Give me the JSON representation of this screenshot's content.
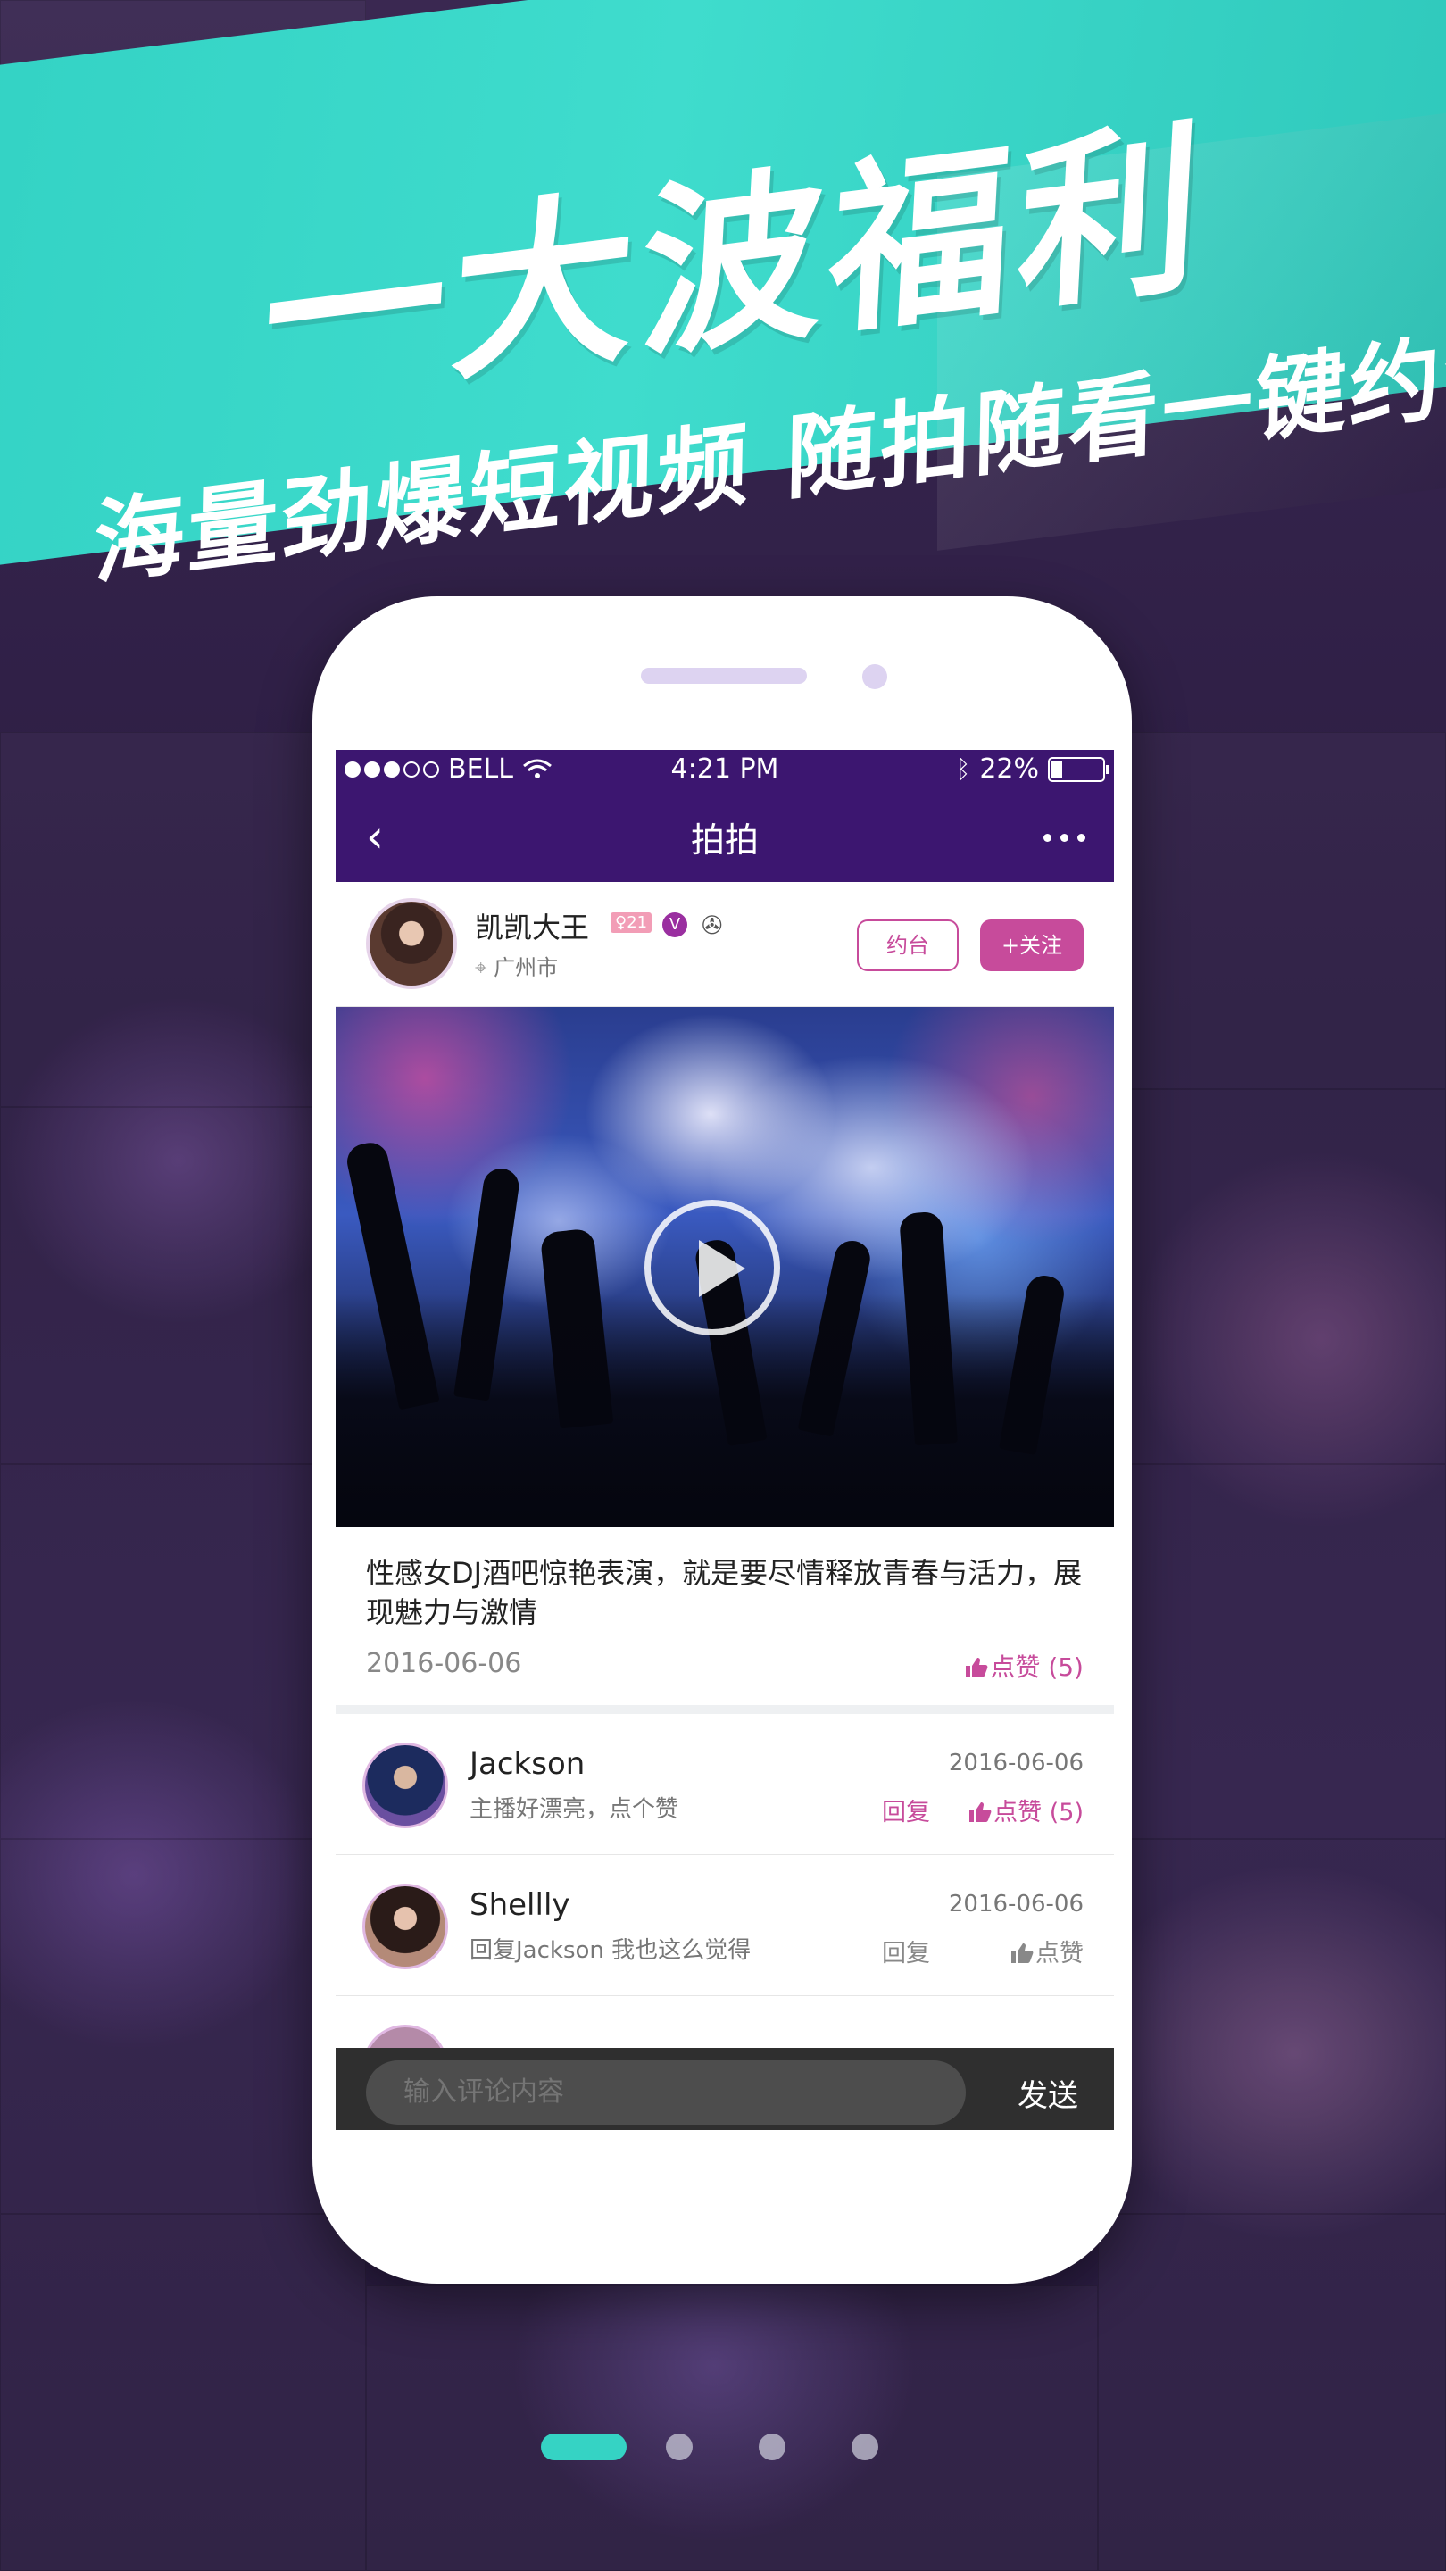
{
  "banner": {
    "headline": "一大波福利",
    "subline": "海量劲爆短视频  随拍随看一键约会",
    "color": "#35d3c4"
  },
  "status_bar": {
    "carrier": "BELL",
    "time": "4:21 PM",
    "battery": "22%",
    "icons": [
      "signal-dots-icon",
      "wifi-icon",
      "bluetooth-icon",
      "battery-icon"
    ]
  },
  "nav": {
    "back_icon": "chevron-left-icon",
    "title": "拍拍",
    "more_icon": "more-dots-icon"
  },
  "post": {
    "user_name": "凯凯大王",
    "level_badge": "21",
    "vip_badge": "V",
    "location": "广州市",
    "date_button": "约台",
    "follow_button": "+关注",
    "description": "性感女DJ酒吧惊艳表演，就是要尽情释放青春与活力，展现魅力与激情",
    "date": "2016-06-06",
    "like_label": "点赞 (5)",
    "accent": "#c74b9b"
  },
  "comments": [
    {
      "name": "Jackson",
      "text": "主播好漂亮，点个赞",
      "date": "2016-06-06",
      "reply_label": "回复",
      "like_label": "点赞 (5)"
    },
    {
      "name": "Shellly",
      "text": "回复Jackson  我也这么觉得",
      "date": "2016-06-06",
      "reply_label": "回复",
      "like_label": "点赞"
    }
  ],
  "comment_input": {
    "placeholder": "输入评论内容",
    "send_label": "发送"
  },
  "pager": {
    "pages": 4,
    "active_index": 0
  }
}
